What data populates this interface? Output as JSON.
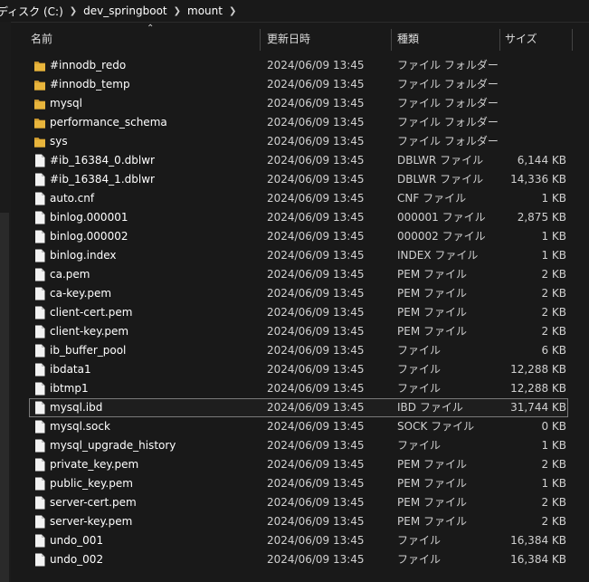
{
  "breadcrumb": [
    "ディスク (C:)",
    "dev_springboot",
    "mount"
  ],
  "columns": {
    "name": "名前",
    "date": "更新日時",
    "type": "種類",
    "size": "サイズ"
  },
  "colors": {
    "background": "#191919",
    "folder": "#e8b53c",
    "file": "#f2f2f2"
  },
  "files": [
    {
      "name": "#innodb_redo",
      "date": "2024/06/09 13:45",
      "type": "ファイル フォルダー",
      "size": "",
      "icon": "folder-icon"
    },
    {
      "name": "#innodb_temp",
      "date": "2024/06/09 13:45",
      "type": "ファイル フォルダー",
      "size": "",
      "icon": "folder-icon"
    },
    {
      "name": "mysql",
      "date": "2024/06/09 13:45",
      "type": "ファイル フォルダー",
      "size": "",
      "icon": "folder-icon"
    },
    {
      "name": "performance_schema",
      "date": "2024/06/09 13:45",
      "type": "ファイル フォルダー",
      "size": "",
      "icon": "folder-icon"
    },
    {
      "name": "sys",
      "date": "2024/06/09 13:45",
      "type": "ファイル フォルダー",
      "size": "",
      "icon": "folder-icon"
    },
    {
      "name": "#ib_16384_0.dblwr",
      "date": "2024/06/09 13:45",
      "type": "DBLWR ファイル",
      "size": "6,144 KB",
      "icon": "file-icon"
    },
    {
      "name": "#ib_16384_1.dblwr",
      "date": "2024/06/09 13:45",
      "type": "DBLWR ファイル",
      "size": "14,336 KB",
      "icon": "file-icon"
    },
    {
      "name": "auto.cnf",
      "date": "2024/06/09 13:45",
      "type": "CNF ファイル",
      "size": "1 KB",
      "icon": "file-icon"
    },
    {
      "name": "binlog.000001",
      "date": "2024/06/09 13:45",
      "type": "000001 ファイル",
      "size": "2,875 KB",
      "icon": "file-icon"
    },
    {
      "name": "binlog.000002",
      "date": "2024/06/09 13:45",
      "type": "000002 ファイル",
      "size": "1 KB",
      "icon": "file-icon"
    },
    {
      "name": "binlog.index",
      "date": "2024/06/09 13:45",
      "type": "INDEX ファイル",
      "size": "1 KB",
      "icon": "file-icon"
    },
    {
      "name": "ca.pem",
      "date": "2024/06/09 13:45",
      "type": "PEM ファイル",
      "size": "2 KB",
      "icon": "file-icon"
    },
    {
      "name": "ca-key.pem",
      "date": "2024/06/09 13:45",
      "type": "PEM ファイル",
      "size": "2 KB",
      "icon": "file-icon"
    },
    {
      "name": "client-cert.pem",
      "date": "2024/06/09 13:45",
      "type": "PEM ファイル",
      "size": "2 KB",
      "icon": "file-icon"
    },
    {
      "name": "client-key.pem",
      "date": "2024/06/09 13:45",
      "type": "PEM ファイル",
      "size": "2 KB",
      "icon": "file-icon"
    },
    {
      "name": "ib_buffer_pool",
      "date": "2024/06/09 13:45",
      "type": "ファイル",
      "size": "6 KB",
      "icon": "file-icon"
    },
    {
      "name": "ibdata1",
      "date": "2024/06/09 13:45",
      "type": "ファイル",
      "size": "12,288 KB",
      "icon": "file-icon"
    },
    {
      "name": "ibtmp1",
      "date": "2024/06/09 13:45",
      "type": "ファイル",
      "size": "12,288 KB",
      "icon": "file-icon"
    },
    {
      "name": "mysql.ibd",
      "date": "2024/06/09 13:45",
      "type": "IBD ファイル",
      "size": "31,744 KB",
      "icon": "file-icon",
      "selected": true
    },
    {
      "name": "mysql.sock",
      "date": "2024/06/09 13:45",
      "type": "SOCK ファイル",
      "size": "0 KB",
      "icon": "file-icon"
    },
    {
      "name": "mysql_upgrade_history",
      "date": "2024/06/09 13:45",
      "type": "ファイル",
      "size": "1 KB",
      "icon": "file-icon"
    },
    {
      "name": "private_key.pem",
      "date": "2024/06/09 13:45",
      "type": "PEM ファイル",
      "size": "2 KB",
      "icon": "file-icon"
    },
    {
      "name": "public_key.pem",
      "date": "2024/06/09 13:45",
      "type": "PEM ファイル",
      "size": "1 KB",
      "icon": "file-icon"
    },
    {
      "name": "server-cert.pem",
      "date": "2024/06/09 13:45",
      "type": "PEM ファイル",
      "size": "2 KB",
      "icon": "file-icon"
    },
    {
      "name": "server-key.pem",
      "date": "2024/06/09 13:45",
      "type": "PEM ファイル",
      "size": "2 KB",
      "icon": "file-icon"
    },
    {
      "name": "undo_001",
      "date": "2024/06/09 13:45",
      "type": "ファイル",
      "size": "16,384 KB",
      "icon": "file-icon"
    },
    {
      "name": "undo_002",
      "date": "2024/06/09 13:45",
      "type": "ファイル",
      "size": "16,384 KB",
      "icon": "file-icon"
    }
  ]
}
